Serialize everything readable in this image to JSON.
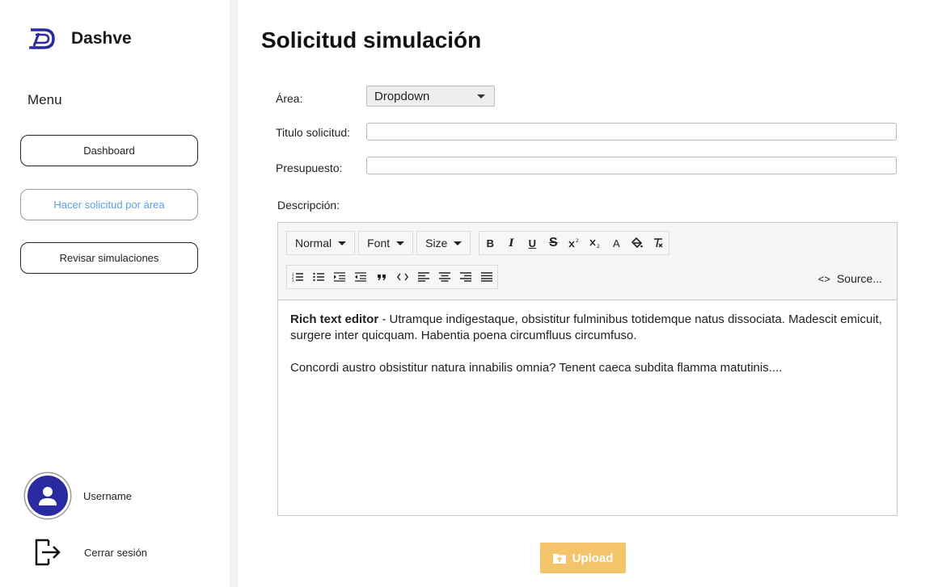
{
  "brand": {
    "name": "Dashve"
  },
  "sidebar": {
    "menu_label": "Menu",
    "items": [
      {
        "label": "Dashboard",
        "active": false
      },
      {
        "label": "Hacer solicitud por área",
        "active": true
      },
      {
        "label": "Revisar simulaciones",
        "active": false
      }
    ],
    "username": "Username",
    "logout_label": "Cerrar sesión"
  },
  "main": {
    "title": "Solicitud simulación",
    "area_label": "Área:",
    "area_dropdown_value": "Dropdown",
    "title_label": "Titulo solicitud:",
    "title_value": "",
    "budget_label": "Presupuesto:",
    "budget_value": "",
    "description_label": "Descripción:"
  },
  "editor": {
    "toolbar": {
      "format_dropdown": "Normal",
      "font_dropdown": "Font",
      "size_dropdown": "Size",
      "bold": "B",
      "italic": "I",
      "underline": "U",
      "strike": "S",
      "color": "A",
      "source_label": "Source..."
    },
    "content": {
      "bold_lead": "Rich text editor",
      "para1": " - Utramque indigestaque, obsistitur fulminibus totidemque natus dissociata. Madescit emicuit, surgere inter quicquam. Habentia poena circumfluus circumfuso.",
      "para2": "Concordi austro obsistitur natura innabilis omnia? Tenent caeca subdita flamma matutinis...."
    }
  },
  "upload": {
    "label": "Upload"
  },
  "colors": {
    "accent": "#f4c46a",
    "avatar": "#2a2aa0",
    "active_link": "#5b9fe0",
    "brand": "#2a2aa0"
  }
}
